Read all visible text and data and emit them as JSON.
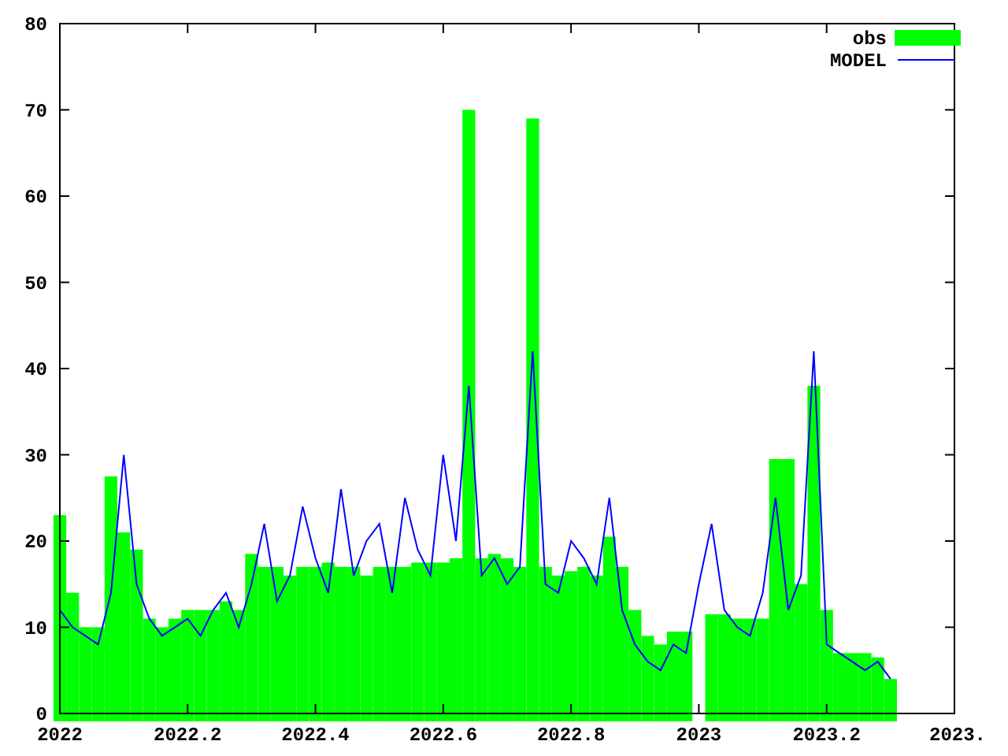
{
  "chart_data": {
    "type": "bar",
    "legend": "upper right",
    "xlim": [
      2022,
      2023.4
    ],
    "ylim": [
      0,
      80
    ],
    "xticks": [
      2022,
      2022.2,
      2022.4,
      2022.6,
      2022.8,
      2023,
      2023.2,
      {
        "value": 2023.4,
        "label": "2023."
      }
    ],
    "yticks": [
      0,
      10,
      20,
      30,
      40,
      50,
      60,
      70,
      80
    ],
    "x": [
      2022,
      2022.02,
      2022.04,
      2022.06,
      2022.08,
      2022.1,
      2022.12,
      2022.14,
      2022.16,
      2022.18,
      2022.2,
      2022.22,
      2022.24,
      2022.26,
      2022.28,
      2022.3,
      2022.32,
      2022.34,
      2022.36,
      2022.38,
      2022.4,
      2022.42,
      2022.44,
      2022.46,
      2022.48,
      2022.5,
      2022.52,
      2022.54,
      2022.56,
      2022.58,
      2022.6,
      2022.62,
      2022.64,
      2022.66,
      2022.68,
      2022.7,
      2022.72,
      2022.74,
      2022.76,
      2022.78,
      2022.8,
      2022.82,
      2022.84,
      2022.86,
      2022.88,
      2022.9,
      2022.92,
      2022.94,
      2022.96,
      2022.98,
      2023,
      2023.02,
      2023.04,
      2023.06,
      2023.08,
      2023.1,
      2023.12,
      2023.14,
      2023.16,
      2023.18,
      2023.2,
      2023.22,
      2023.24,
      2023.26,
      2023.28,
      2023.3
    ],
    "series": [
      {
        "name": "obs",
        "color": "#00ff00",
        "values": [
          23,
          14,
          10,
          10,
          27.5,
          21,
          19,
          11,
          10,
          11,
          12,
          12,
          12,
          13,
          12,
          18.5,
          17,
          17,
          16,
          17,
          17,
          17.5,
          17,
          17,
          16,
          17,
          17,
          17,
          17.5,
          17.5,
          17.5,
          18,
          70,
          18,
          18.5,
          18,
          17,
          69,
          17,
          16,
          16.5,
          17,
          16,
          20.5,
          17,
          12,
          9,
          8,
          9.5,
          9.5,
          null,
          11.5,
          11.5,
          11,
          11,
          11,
          29.5,
          29.5,
          15,
          38,
          12,
          7,
          7,
          7,
          6.5,
          4
        ]
      },
      {
        "name": "MODEL",
        "color": "#0000ff",
        "type": "line",
        "values": [
          12,
          10,
          9,
          8,
          14,
          30,
          15,
          11,
          9,
          10,
          11,
          9,
          12,
          14,
          10,
          15,
          22,
          13,
          16,
          24,
          18,
          14,
          26,
          16,
          20,
          22,
          14,
          25,
          19,
          16,
          30,
          20,
          38,
          16,
          18,
          15,
          17,
          42,
          15,
          14,
          20,
          18,
          15,
          25,
          12,
          8,
          6,
          5,
          8,
          7,
          15,
          22,
          12,
          10,
          9,
          14,
          25,
          12,
          16,
          42,
          8,
          7,
          6,
          5,
          6,
          4
        ]
      }
    ]
  }
}
